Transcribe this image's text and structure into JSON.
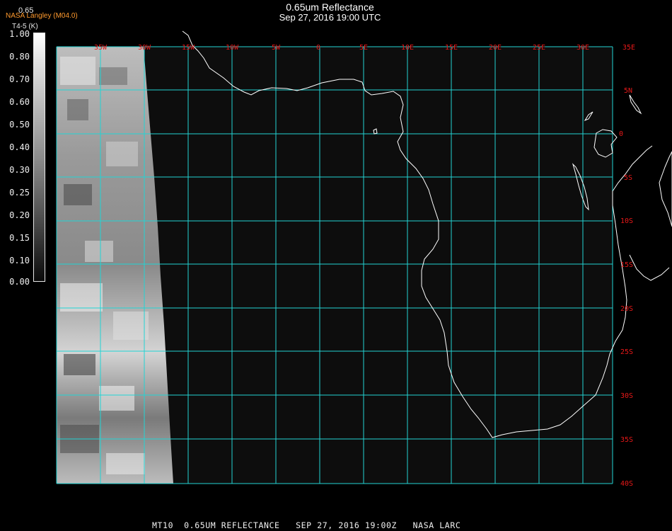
{
  "header": {
    "title": "0.65um Reflectance",
    "subtitle": "Sep 27, 2016 19:00 UTC"
  },
  "credit": {
    "organization": "NASA Langley (M04.0)",
    "band_label": "T4-5 (K)",
    "overlap_label": "0.65"
  },
  "colors": {
    "background": "#000000",
    "grid": "#22d4d4",
    "grid_labels": "#e81818",
    "coastline": "#ffffff",
    "credit_text": "#ff9a2e"
  },
  "colorbar": {
    "labels": [
      "1.00",
      "0.80",
      "0.70",
      "0.60",
      "0.50",
      "0.40",
      "0.30",
      "0.25",
      "0.20",
      "0.15",
      "0.10",
      "0.00"
    ]
  },
  "map": {
    "longitude_labels": [
      "35W",
      "30W",
      "15W",
      "10W",
      "5W",
      "0",
      "5E",
      "10E",
      "15E",
      "20E",
      "25E",
      "30E",
      "35E"
    ],
    "latitude_labels": [
      "5N",
      "0",
      "5S",
      "10S",
      "15S",
      "20S",
      "25S",
      "30S",
      "35S",
      "40S"
    ],
    "features": [
      "satellite-imagery-swath",
      "africa-coastline",
      "lake-victoria",
      "madagascar",
      "bioko-island"
    ]
  },
  "footer": {
    "caption": "MT10  0.65UM REFLECTANCE   SEP 27, 2016 19:00Z   NASA LARC"
  }
}
